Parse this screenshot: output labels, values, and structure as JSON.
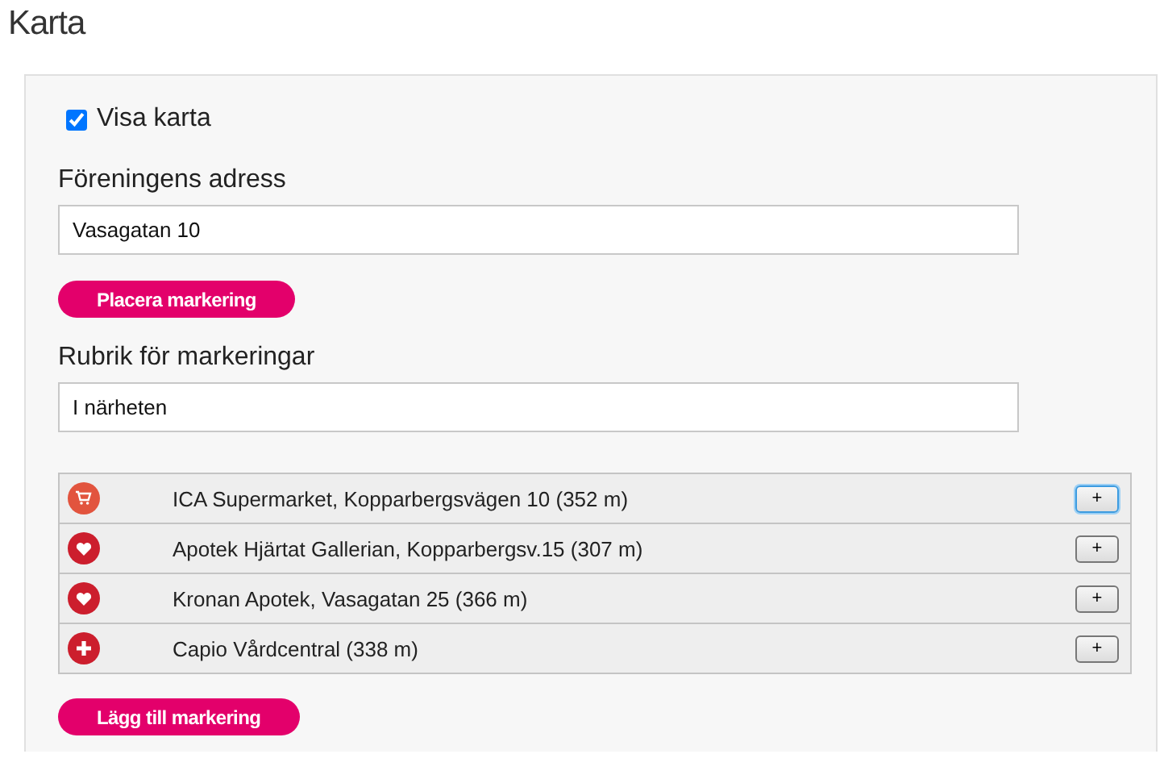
{
  "heading": "Karta",
  "show_map": {
    "label": "Visa karta",
    "checked": true
  },
  "address": {
    "label": "Föreningens adress",
    "value": "Vasagatan 10"
  },
  "place_button": "Placera markering",
  "marker_title": {
    "label": "Rubrik för markeringar",
    "value": "I närheten"
  },
  "places": [
    {
      "kind": "shop",
      "name": "ICA Supermarket, Kopparbergsvägen 10 (352 m)",
      "button": "+",
      "focused": true
    },
    {
      "kind": "pharmacy",
      "name": "Apotek Hjärtat Gallerian, Kopparbergsv.15 (307 m)",
      "button": "+",
      "focused": false
    },
    {
      "kind": "pharmacy",
      "name": "Kronan Apotek, Vasagatan 25 (366 m)",
      "button": "+",
      "focused": false
    },
    {
      "kind": "clinic",
      "name": "Capio Vårdcentral (338 m)",
      "button": "+",
      "focused": false
    }
  ],
  "add_button": "Lägg till markering"
}
